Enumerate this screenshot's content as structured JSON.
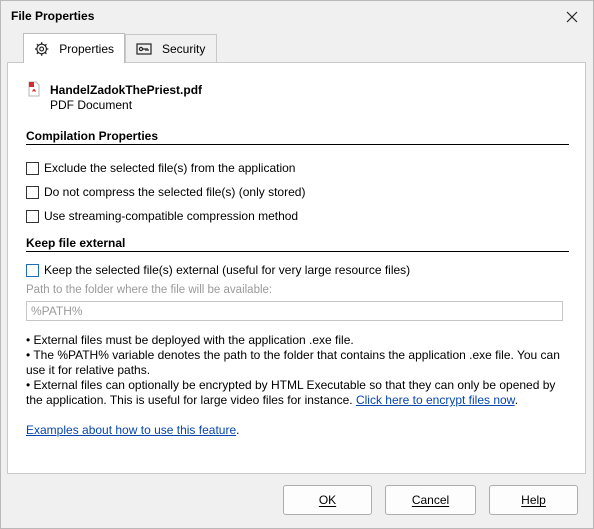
{
  "window": {
    "title": "File Properties"
  },
  "tabs": [
    {
      "label": "Properties",
      "icon": "gear-icon",
      "active": true
    },
    {
      "label": "Security",
      "icon": "key-card-icon",
      "active": false
    }
  ],
  "file": {
    "name": "HandelZadokThePriest.pdf",
    "type": "PDF Document",
    "icon": "pdf-icon"
  },
  "compilation": {
    "title": "Compilation Properties",
    "options": [
      {
        "label": "Exclude the selected file(s) from the application",
        "checked": false
      },
      {
        "label": "Do not compress the selected file(s) (only stored)",
        "checked": false
      },
      {
        "label": "Use streaming-compatible compression method",
        "checked": false
      }
    ]
  },
  "external": {
    "title": "Keep file external",
    "keep_label": "Keep the selected file(s) external (useful for very large resource files)",
    "path_label": "Path to the folder where the file will be available:",
    "path_value": "%PATH%",
    "notes": [
      "•  External files must be deployed with the application .exe file.",
      "•  The %PATH% variable denotes the path to the folder that contains the application .exe file. You can use it for relative paths.",
      "•  External files can optionally be encrypted by HTML Executable so that they can only be opened by the application. This is useful for large video files for instance. "
    ],
    "encrypt_link": "Click here to encrypt files now",
    "encrypt_link_suffix": ".",
    "examples_link": "Examples about how to use this feature",
    "examples_suffix": "."
  },
  "buttons": {
    "ok": "OK",
    "cancel": "Cancel",
    "help": "Help"
  }
}
